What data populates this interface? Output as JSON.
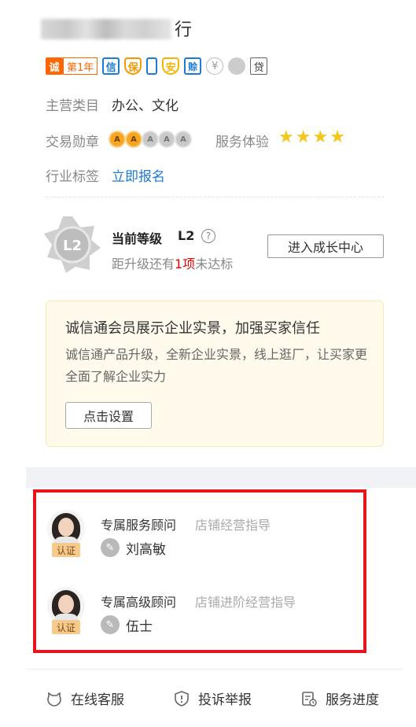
{
  "shop": {
    "title_suffix": "行",
    "badges": {
      "cheng": "诚",
      "year": "第1年",
      "xin": "信",
      "bao": "保",
      "an": "安",
      "pei": "赊",
      "yen": "¥",
      "dai": "贷"
    },
    "main_category_label": "主营类目",
    "main_category_value": "办公、文化",
    "medal_label": "交易勋章",
    "medal_letter": "A",
    "medals_lit": 2,
    "medals_total": 5,
    "service_label": "服务体验",
    "service_stars": 4,
    "industry_label": "行业标签",
    "industry_link": "立即报名"
  },
  "level": {
    "title": "当前等级",
    "value": "L2",
    "badge_text": "L2",
    "help_icon": "?",
    "sub_prefix": "距升级还有",
    "sub_count": "1项",
    "sub_suffix": "未达标",
    "growth_button": "进入成长中心"
  },
  "promo": {
    "title": "诚信通会员展示企业实景，加强买家信任",
    "desc": "诚信通产品升级，全新企业实景，线上逛厂，让买家更全面了解企业实力",
    "button": "点击设置"
  },
  "consultants": [
    {
      "role": "专属服务顾问",
      "desc": "店铺经营指导",
      "name": "刘高敏",
      "cert": "认证"
    },
    {
      "role": "专属高级顾问",
      "desc": "店铺进阶经营指导",
      "name": "伍士",
      "cert": "认证"
    }
  ],
  "footer": {
    "service": "在线客服",
    "complain": "投诉举报",
    "progress": "服务进度"
  },
  "colors": {
    "accent_orange": "#ff6600",
    "link_blue": "#1c7bd6",
    "highlight_red": "#e00000",
    "star_yellow": "#f5c518",
    "box_red": "#e8141c"
  }
}
